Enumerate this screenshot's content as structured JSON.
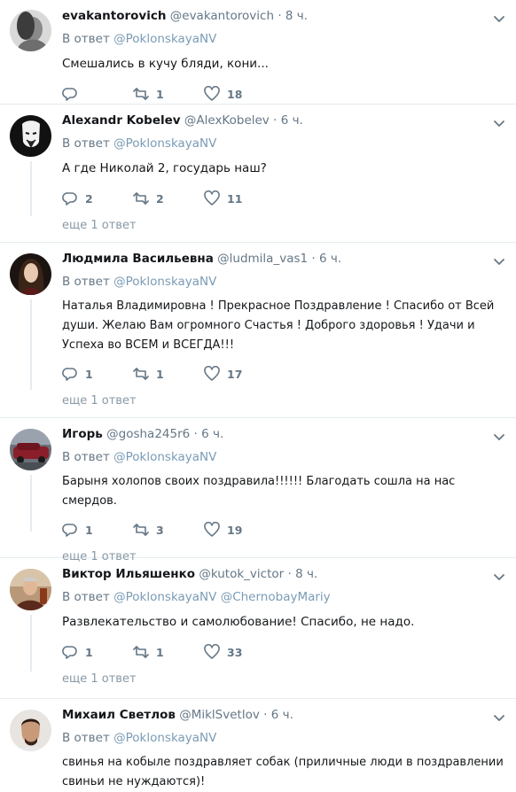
{
  "tweets": [
    {
      "name": "evakantorovich",
      "handle": "@evakantorovich",
      "dot": "·",
      "time": "8 ч.",
      "reply_prefix": "В ответ",
      "reply_to": "@PoklonskayaNV",
      "reply_to_2": "",
      "text": "Смешались в кучу бляди, кони...",
      "replies": "",
      "retweets": "1",
      "likes": "18",
      "more_replies": ""
    },
    {
      "name": "Alexandr Kobelev",
      "handle": "@AlexKobelev",
      "dot": "·",
      "time": "6 ч.",
      "reply_prefix": "В ответ",
      "reply_to": "@PoklonskayaNV",
      "reply_to_2": "",
      "text": "А где Николай 2, государь наш?",
      "replies": "2",
      "retweets": "2",
      "likes": "11",
      "more_replies": "еще 1 ответ"
    },
    {
      "name": "Людмила Васильевна",
      "handle": "@ludmila_vas1",
      "dot": "·",
      "time": "6 ч.",
      "reply_prefix": "В ответ",
      "reply_to": "@PoklonskayaNV",
      "reply_to_2": "",
      "text": "Наталья Владимировна ! Прекрасное Поздравление ! Спасибо от Всей души. Желаю Вам огромного Счастья ! Доброго здоровья ! Удачи и Успеха во ВСЕМ и ВСЕГДА!!!",
      "replies": "1",
      "retweets": "1",
      "likes": "17",
      "more_replies": "еще 1 ответ"
    },
    {
      "name": "Игорь",
      "handle": "@gosha245r6",
      "dot": "·",
      "time": "6 ч.",
      "reply_prefix": "В ответ",
      "reply_to": "@PoklonskayaNV",
      "reply_to_2": "",
      "text": "Барыня холопов своих поздравила!!!!!! Благодать сошла на нас смердов.",
      "replies": "1",
      "retweets": "3",
      "likes": "19",
      "more_replies": "еще 1 ответ"
    },
    {
      "name": "Виктор Ильяшенко",
      "handle": "@kutok_victor",
      "dot": "·",
      "time": "8 ч.",
      "reply_prefix": "В ответ",
      "reply_to": "@PoklonskayaNV",
      "reply_to_2": "@ChernobayMariy",
      "text": "Развлекательство и самолюбование! Спасибо, не надо.",
      "replies": "1",
      "retweets": "1",
      "likes": "33",
      "more_replies": "еще 1 ответ"
    },
    {
      "name": "Михаил Светлов",
      "handle": "@MiklSvetlov",
      "dot": "·",
      "time": "6 ч.",
      "reply_prefix": "В ответ",
      "reply_to": "@PoklonskayaNV",
      "reply_to_2": "",
      "text": "свинья на кобыле поздравляет собак (приличные люди в поздравлении свиньи не нуждаются)!",
      "replies": "",
      "retweets": "",
      "likes": "",
      "more_replies": ""
    }
  ],
  "icons": {
    "reply": "reply-icon",
    "retweet": "retweet-icon",
    "like": "heart-icon",
    "menu": "chevron-down-icon"
  },
  "colors": {
    "text": "#14171a",
    "secondary": "#657786",
    "link_faded": "#7a9bb5",
    "divider": "#e6ecf0"
  }
}
